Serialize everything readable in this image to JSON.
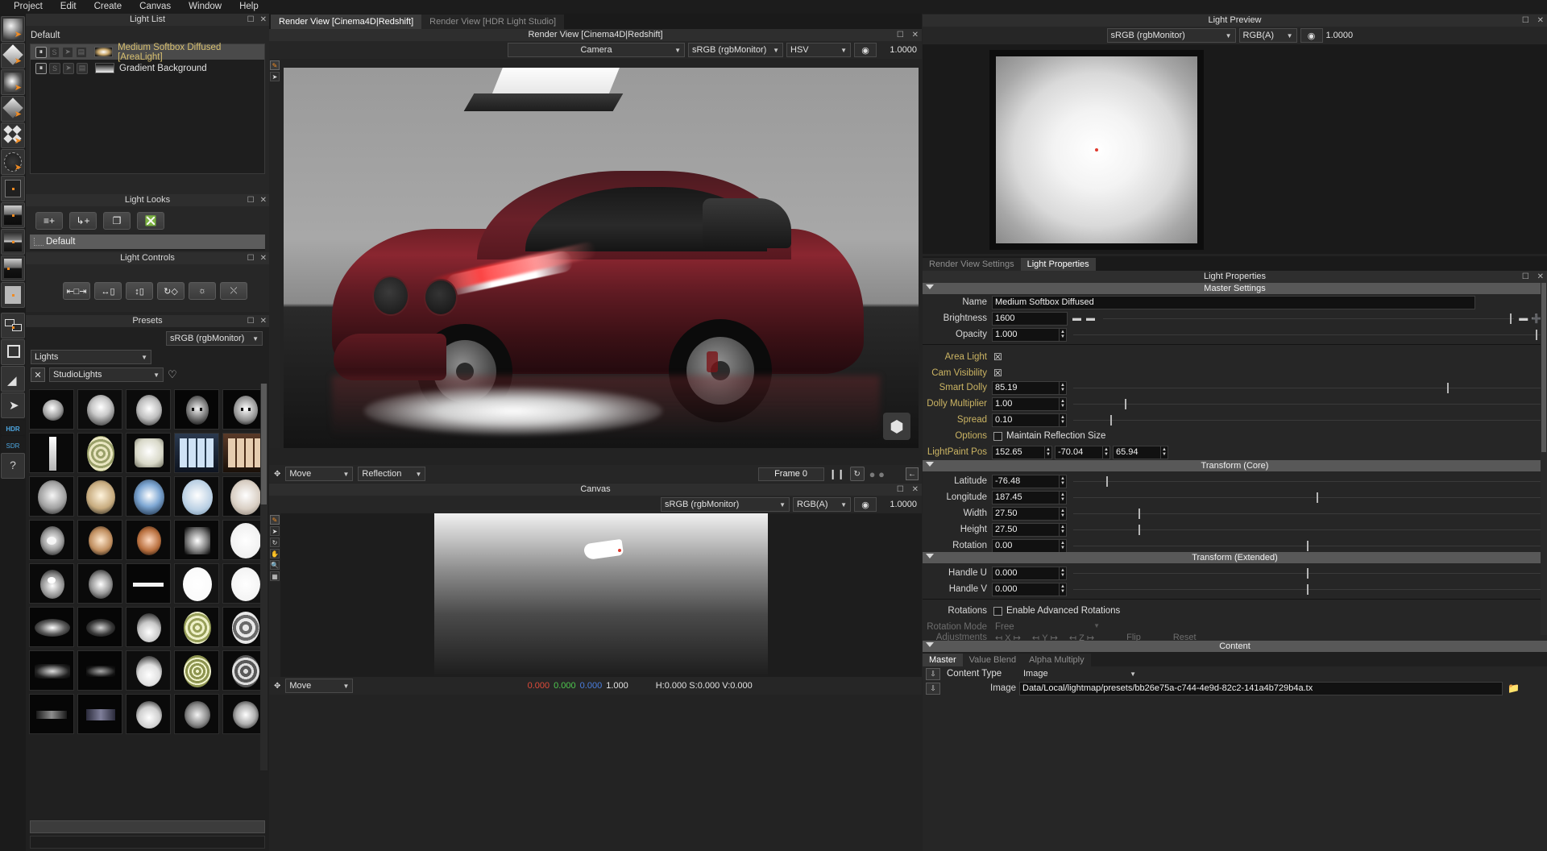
{
  "menubar": {
    "items": [
      "Project",
      "Edit",
      "Create",
      "Canvas",
      "Window",
      "Help"
    ]
  },
  "panels": {
    "light_list": {
      "title": "Light List",
      "default_label": "Default",
      "rows": [
        {
          "name": "Medium Softbox Diffused [AreaLight]",
          "selected": true,
          "swatch": "softbox"
        },
        {
          "name": "Gradient Background",
          "selected": false,
          "swatch": "gradient"
        }
      ],
      "toggle_glyphs": [
        "Ⓘ",
        "S",
        "➤",
        "▤"
      ]
    },
    "light_looks": {
      "title": "Light Looks",
      "row": "Default",
      "buttons": [
        "add-look",
        "add-child-look",
        "duplicate-look",
        "delete-look"
      ]
    },
    "light_controls": {
      "title": "Light Controls",
      "buttons": [
        "scale",
        "width",
        "height",
        "rotate",
        "brightness",
        "move-diagonal"
      ]
    },
    "presets": {
      "title": "Presets",
      "colorspace": "sRGB (rgbMonitor)",
      "category": "Lights",
      "subcategory": "StudioLights"
    }
  },
  "render_view": {
    "tabs": [
      {
        "label": "Render View [Cinema4D|Redshift]",
        "active": true
      },
      {
        "label": "Render View [HDR Light Studio]",
        "active": false
      }
    ],
    "title": "Render View [Cinema4D|Redshift]",
    "camera": "Camera",
    "colorspace": "sRGB (rgbMonitor)",
    "channel": "HSV",
    "exposure": "1.0000",
    "footer": {
      "mode": "Move",
      "type": "Reflection",
      "frame": "Frame 0"
    }
  },
  "canvas": {
    "title": "Canvas",
    "colorspace": "sRGB (rgbMonitor)",
    "channel": "RGB(A)",
    "exposure": "1.0000",
    "footer_mode": "Move",
    "readout": {
      "r": "0.000",
      "g": "0.000",
      "b": "0.000",
      "a": "1.000",
      "hsv": "H:0.000 S:0.000 V:0.000"
    }
  },
  "light_preview": {
    "title": "Light Preview",
    "colorspace": "sRGB (rgbMonitor)",
    "channel": "RGB(A)",
    "exposure": "1.0000"
  },
  "right_tabs": [
    {
      "label": "Render View Settings",
      "active": false
    },
    {
      "label": "Light Properties",
      "active": true
    }
  ],
  "light_properties": {
    "title": "Light Properties",
    "sections": {
      "master": {
        "header": "Master Settings",
        "name_label": "Name",
        "name_value": "Medium Softbox Diffused",
        "brightness_label": "Brightness",
        "brightness_value": "1600",
        "opacity_label": "Opacity",
        "opacity_value": "1.000",
        "area_light_label": "Area Light",
        "cam_visibility_label": "Cam Visibility",
        "smart_dolly_label": "Smart Dolly",
        "smart_dolly_value": "85.19",
        "dolly_multiplier_label": "Dolly Multiplier",
        "dolly_multiplier_value": "1.00",
        "spread_label": "Spread",
        "spread_value": "0.10",
        "options_label": "Options",
        "options_checkbox": "Maintain Reflection Size",
        "lightpaint_label": "LightPaint Pos",
        "lightpaint_values": [
          "152.65",
          "-70.04",
          "65.94"
        ]
      },
      "transform_core": {
        "header": "Transform (Core)",
        "rows": [
          {
            "label": "Latitude",
            "value": "-76.48",
            "knob": 7
          },
          {
            "label": "Longitude",
            "value": "187.45",
            "knob": 52
          },
          {
            "label": "Width",
            "value": "27.50",
            "knob": 14
          },
          {
            "label": "Height",
            "value": "27.50",
            "knob": 14
          },
          {
            "label": "Rotation",
            "value": "0.00",
            "knob": 50
          }
        ]
      },
      "transform_extended": {
        "header": "Transform (Extended)",
        "rows": [
          {
            "label": "Handle U",
            "value": "0.000",
            "knob": 50
          },
          {
            "label": "Handle V",
            "value": "0.000",
            "knob": 50
          }
        ],
        "rotations_label": "Rotations",
        "rotations_checkbox": "Enable Advanced Rotations",
        "rotation_mode_label": "Rotation Mode",
        "rotation_mode_value": "Free",
        "adjustments_label": "Adjustments",
        "adjustments_axes": [
          "X",
          "Y",
          "Z"
        ],
        "flip_label": "Flip",
        "reset_label": "Reset"
      },
      "content": {
        "header": "Content",
        "tabs": [
          {
            "label": "Master",
            "active": true
          },
          {
            "label": "Value Blend",
            "active": false
          },
          {
            "label": "Alpha Multiply",
            "active": false
          }
        ],
        "content_type_label": "Content Type",
        "content_type_value": "Image",
        "image_label": "Image",
        "image_value": "Data/Local/lightmap/presets/bb26e75a-c744-4e9d-82c2-141a4b729b4a.tx"
      }
    }
  },
  "sliders": {
    "brightness_knob": 99,
    "opacity_knob": 99,
    "smart_dolly_knob": 80,
    "dolly_multiplier_knob": 11,
    "spread_knob": 8
  }
}
